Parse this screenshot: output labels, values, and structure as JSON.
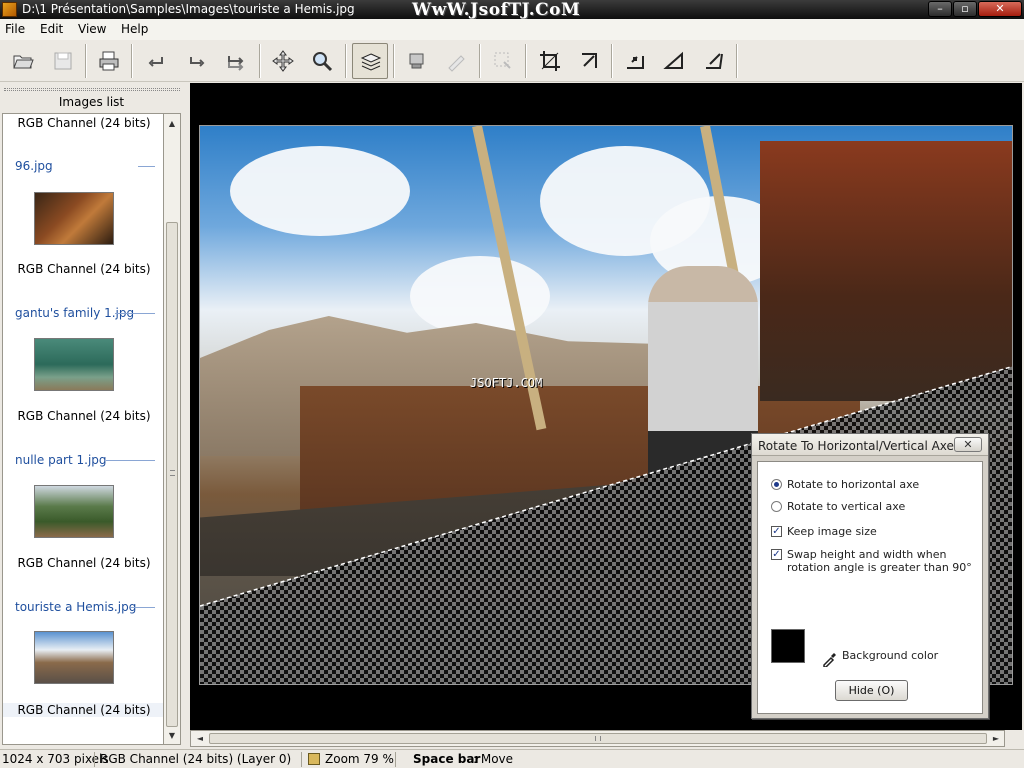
{
  "window": {
    "title": "D:\\1 Présentation\\Samples\\Images\\touriste a Hemis.jpg",
    "watermark": "WwW.JsofTJ.CoM",
    "controls": {
      "minimize": "–",
      "maximize": "▫",
      "close": "✕"
    }
  },
  "menu": [
    "File",
    "Edit",
    "View",
    "Help"
  ],
  "toolbar": {
    "icons": [
      "open-icon",
      "save-icon",
      "print-icon",
      "undo-icon",
      "redo-icon",
      "redo-all-icon",
      "move-icon",
      "zoom-icon",
      "layers-icon",
      "copy-icon",
      "paste-icon",
      "select-icon",
      "crop-icon",
      "resize-icon",
      "rotate-icon",
      "skew-icon",
      "perspective-icon"
    ]
  },
  "images_panel": {
    "title": "Images list",
    "scroll_up": "▲",
    "scroll_down": "▼",
    "items": [
      {
        "name": "",
        "channel": "RGB Channel (24 bits)"
      },
      {
        "name": "96.jpg",
        "channel": "RGB Channel (24 bits)"
      },
      {
        "name": "gantu's family 1.jpg",
        "channel": "RGB Channel (24 bits)"
      },
      {
        "name": "nulle part 1.jpg",
        "channel": "RGB Channel (24 bits)"
      },
      {
        "name": "touriste a Hemis.jpg",
        "channel": "RGB Channel (24 bits)"
      }
    ]
  },
  "viewer": {
    "overlay_text": "JSOFTJ.COM",
    "hscroll_left": "◄",
    "hscroll_right": "►"
  },
  "dialog": {
    "title": "Rotate To Horizontal/Vertical Axe",
    "close_label": "✕",
    "options": {
      "horizontal": "Rotate to horizontal axe",
      "vertical": "Rotate to vertical axe",
      "keep_size": "Keep image size",
      "swap": "Swap height and width when rotation angle is greater than 90°"
    },
    "selected_axis": "horizontal",
    "keep_size_checked": true,
    "swap_checked": true,
    "check_mark": "✓",
    "background_color": "#000000",
    "background_label": "Background color",
    "hide_button": "Hide (O)"
  },
  "status": {
    "dimensions": "1024 x 703 pixels",
    "channel": "RGB Channel (24 bits) (Layer 0)",
    "zoom": "Zoom 79 %",
    "hint_key": "Space bar",
    "hint_action": ": Move"
  }
}
